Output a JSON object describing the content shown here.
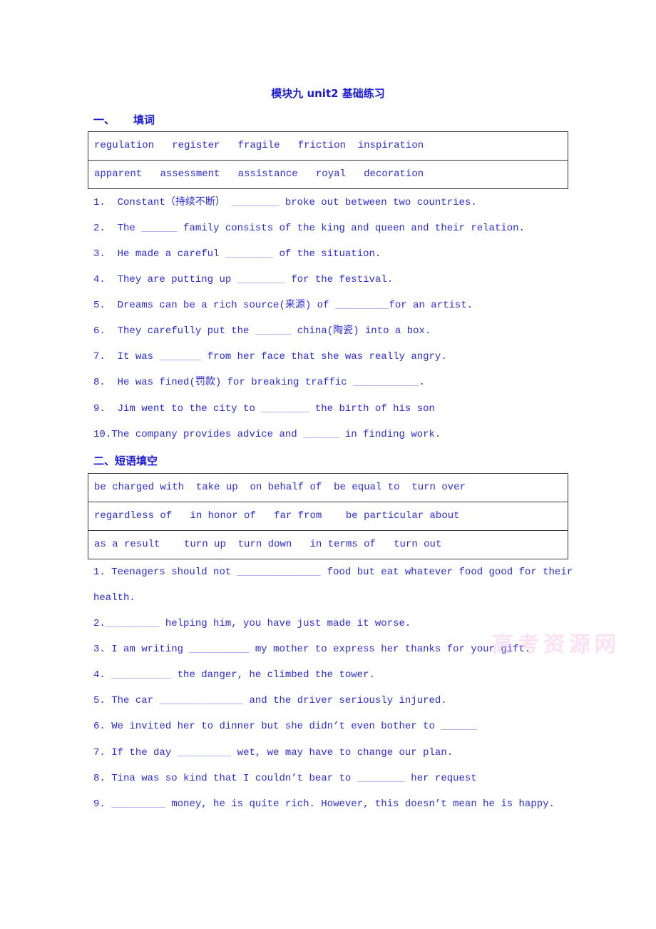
{
  "document": {
    "title": "模块九 unit2 基础练习"
  },
  "section1": {
    "number": "一、",
    "heading": "填词",
    "word_bank_rows": [
      [
        "regulation",
        "register",
        "fragile",
        "friction",
        "inspiration"
      ],
      [
        "apparent",
        "assessment",
        "assistance",
        "royal",
        "decoration"
      ]
    ],
    "questions": [
      {
        "num": "1.",
        "before": "Constant（持续不断）",
        "blank": "________",
        "after": " broke out between two countries."
      },
      {
        "num": "2.",
        "before": "The",
        "blank": "______",
        "after": " family consists of the king and queen and their relation."
      },
      {
        "num": "3.",
        "before": "He made a careful",
        "blank": "________",
        "after": " of the situation."
      },
      {
        "num": "4.",
        "before": "They are putting up",
        "blank": "________",
        "after": " for the festival."
      },
      {
        "num": "5.",
        "before": "Dreams can be a rich source(来源) of",
        "blank": "_________",
        "after": "for an artist."
      },
      {
        "num": "6.",
        "before": "They carefully put the",
        "blank": "______",
        "after": " china(陶瓷) into a box."
      },
      {
        "num": "7.",
        "before": "It was",
        "blank": "_______",
        "after": " from her face that she was really angry."
      },
      {
        "num": "8.",
        "before": "He was fined(罚款) for breaking traffic",
        "blank": "___________",
        "after": "."
      },
      {
        "num": "9.",
        "before": "Jim went to the city to",
        "blank": "________",
        "after": " the birth of his son"
      },
      {
        "num": "10.",
        "before": "The company provides advice and",
        "blank": "______",
        "after": " in finding work."
      }
    ]
  },
  "section2": {
    "number": "二、",
    "heading": "短语填空",
    "phrase_bank_rows": [
      [
        "be charged with",
        "take up",
        "on behalf of",
        "be equal to",
        "turn over"
      ],
      [
        "regardless of",
        "in honor of",
        "far from",
        "be particular about"
      ],
      [
        "as a result",
        "turn up",
        "turn down",
        "in terms of",
        "turn out"
      ]
    ],
    "questions": [
      {
        "num": "1.",
        "before": "Teenagers should not",
        "blank": "______________",
        "after": " food but eat whatever food good for their",
        "continuation": "health."
      },
      {
        "num": "2.",
        "before": "",
        "blank": "_________",
        "after": " helping him, you have just made it worse."
      },
      {
        "num": "3.",
        "before": "I am writing",
        "blank": "__________",
        "after": " my mother to express her thanks for your gift."
      },
      {
        "num": "4.",
        "before": "",
        "blank": "__________",
        "after": " the danger, he climbed the tower."
      },
      {
        "num": "5.",
        "before": "The car",
        "blank": "______________",
        "after": " and the driver seriously injured."
      },
      {
        "num": "6.",
        "before": "We invited her to dinner but she didn’t even bother to",
        "blank": "______",
        "after": ""
      },
      {
        "num": "7.",
        "before": "If the day",
        "blank": "_________",
        "after": " wet, we may have to change our plan."
      },
      {
        "num": "8.",
        "before": "Tina was so kind that I couldn’t bear to",
        "blank": "________",
        "after": " her request"
      },
      {
        "num": "9.",
        "before": "",
        "blank": "_________",
        "after": " money, he is quite rich. However, this doesn’t mean he is happy."
      }
    ]
  },
  "watermark": {
    "text": "高考资源网"
  },
  "colors": {
    "text": "#2b2bd9",
    "heading": "#1a1ad6",
    "border": "#3a3a3a",
    "watermark": "#f0aadc"
  }
}
